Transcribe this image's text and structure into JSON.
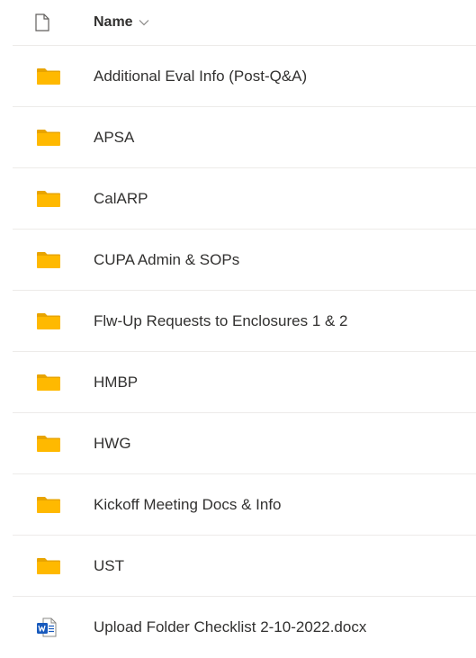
{
  "header": {
    "name_label": "Name"
  },
  "items": [
    {
      "name": "Additional Eval Info (Post-Q&A)",
      "type": "folder"
    },
    {
      "name": "APSA",
      "type": "folder"
    },
    {
      "name": "CalARP",
      "type": "folder"
    },
    {
      "name": "CUPA Admin & SOPs",
      "type": "folder"
    },
    {
      "name": "Flw-Up Requests to Enclosures 1 & 2",
      "type": "folder"
    },
    {
      "name": "HMBP",
      "type": "folder"
    },
    {
      "name": "HWG",
      "type": "folder"
    },
    {
      "name": "Kickoff Meeting Docs & Info",
      "type": "folder"
    },
    {
      "name": "UST",
      "type": "folder"
    },
    {
      "name": "Upload Folder Checklist 2-10-2022.docx",
      "type": "word-document"
    }
  ],
  "colors": {
    "folder": "#ffb900",
    "folder_tab": "#e8a400",
    "word": "#185abd",
    "divider": "#edebe9",
    "text": "#323130"
  }
}
